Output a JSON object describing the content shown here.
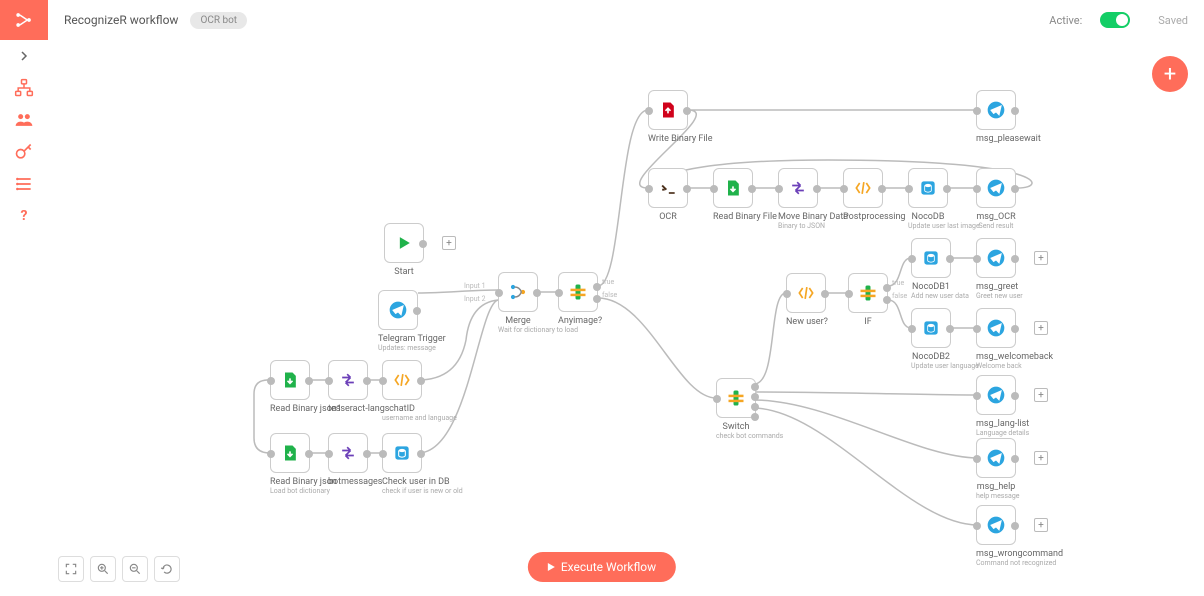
{
  "workflow_name": "RecognizeR workflow",
  "tag": "OCR bot",
  "active_label": "Active:",
  "saved_label": "Saved",
  "execute_label": "Execute Workflow",
  "nodes": {
    "start": {
      "label": "Start"
    },
    "telegram_trigger": {
      "label": "Telegram Trigger",
      "sub": "Updates: message"
    },
    "read_binary_json1": {
      "label": "Read Binary json1"
    },
    "tesseract_langs": {
      "label": "tesseract-langs"
    },
    "chatid": {
      "label": "chatID",
      "sub": "username and language"
    },
    "read_binary_json": {
      "label": "Read Binary json",
      "sub": "Load bot dictionary"
    },
    "botmessages": {
      "label": "botmessages"
    },
    "check_user": {
      "label": "Check user in DB",
      "sub": "check if user is new or old"
    },
    "merge": {
      "label": "Merge",
      "sub": "Wait for dictionary to load",
      "in1": "Input 1",
      "in2": "Input 2"
    },
    "anyimage": {
      "label": "Anyimage?",
      "true": "true",
      "false": "false"
    },
    "write_binary": {
      "label": "Write Binary File"
    },
    "ocr": {
      "label": "OCR"
    },
    "read_binary_file": {
      "label": "Read Binary File"
    },
    "move_binary": {
      "label": "Move Binary Data",
      "sub": "Binary to JSON"
    },
    "postprocessing": {
      "label": "Postprocessing"
    },
    "nocodb": {
      "label": "NocoDB",
      "sub": "Update user last image"
    },
    "msg_ocr": {
      "label": "msg_OCR",
      "sub": "Send result"
    },
    "msg_pleasewait": {
      "label": "msg_pleasewait"
    },
    "switch": {
      "label": "Switch",
      "sub": "check bot commands"
    },
    "new_user": {
      "label": "New user?"
    },
    "if": {
      "label": "IF",
      "true": "true",
      "false": "false"
    },
    "nocodb1": {
      "label": "NocoDB1",
      "sub": "Add new user data"
    },
    "nocodb2": {
      "label": "NocoDB2",
      "sub": "Update user language"
    },
    "msg_greet": {
      "label": "msg_greet",
      "sub": "Greet new user"
    },
    "msg_welcomeback": {
      "label": "msg_welcomeback",
      "sub": "Welcome back"
    },
    "msg_langlist": {
      "label": "msg_lang-list",
      "sub": "Language details"
    },
    "msg_help": {
      "label": "msg_help",
      "sub": "help message"
    },
    "msg_wrongcommand": {
      "label": "msg_wrongcommand",
      "sub": "Command not recognized"
    }
  }
}
